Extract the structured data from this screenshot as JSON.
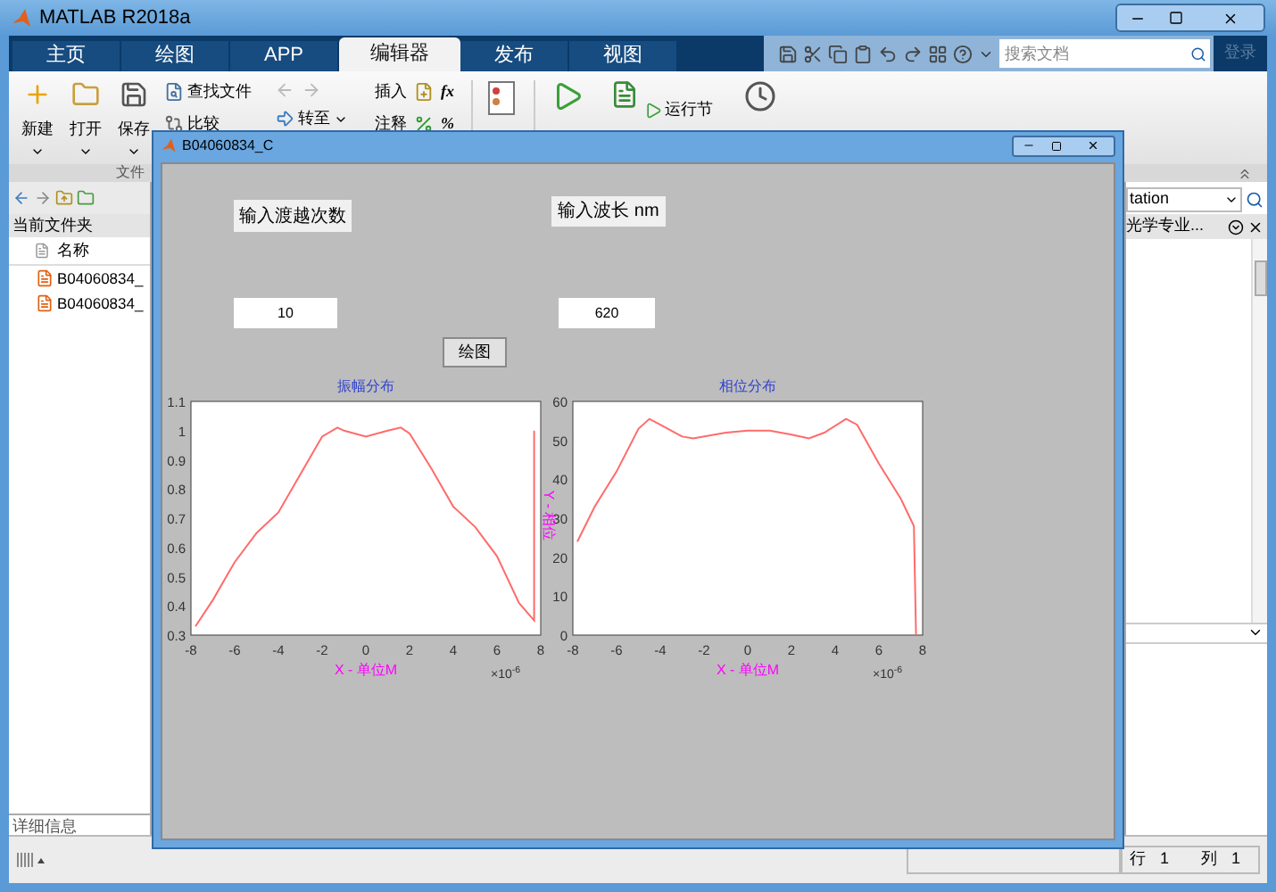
{
  "window": {
    "title": "MATLAB R2018a"
  },
  "tabs": [
    {
      "label": "主页",
      "selected": false
    },
    {
      "label": "绘图",
      "selected": false
    },
    {
      "label": "APP",
      "selected": false
    },
    {
      "label": "编辑器",
      "selected": true
    },
    {
      "label": "发布",
      "selected": false
    },
    {
      "label": "视图",
      "selected": false
    }
  ],
  "search": {
    "placeholder": "搜索文档"
  },
  "sign_in": "登录",
  "toolstrip": {
    "large_buttons": [
      {
        "label": "新建"
      },
      {
        "label": "打开"
      },
      {
        "label": "保存"
      }
    ],
    "file_buttons": [
      "查找文件",
      "比较"
    ],
    "navigate_buttons": [
      "转至"
    ],
    "edit_buttons": [
      "插入",
      "注释"
    ],
    "edit_symbols": [
      "fx",
      "%"
    ],
    "run_buttons": [
      "运行节"
    ],
    "section_label": "文件"
  },
  "left_panel": {
    "title": "当前文件夹",
    "column": "名称",
    "files": [
      "B04060834_",
      "B04060834_"
    ],
    "details": "详细信息"
  },
  "right_panel": {
    "field_value": "tation",
    "item": "光学专业..."
  },
  "status_bar": {
    "row_label": "行",
    "row": "1",
    "col_label": "列",
    "col": "1"
  },
  "figure": {
    "title": "B04060834_C",
    "controls": [
      {
        "kind": "label",
        "text": "输入渡越次数"
      },
      {
        "kind": "label",
        "text": "输入波长 nm"
      },
      {
        "kind": "field",
        "value": "10"
      },
      {
        "kind": "field",
        "value": "620"
      },
      {
        "kind": "button",
        "text": "绘图"
      }
    ],
    "charts": [
      {
        "chart_data": {
          "type": "line",
          "title": "振幅分布",
          "xlabel": "X - 单位M",
          "x": [
            -7.8,
            -7,
            -6,
            -5,
            -4,
            -3,
            -2,
            -1.3,
            -1,
            0,
            1,
            1.6,
            2,
            3,
            4,
            5,
            6,
            7,
            7.7,
            7.7
          ],
          "series": [
            {
              "color": "#ff6b6b",
              "values": [
                0.33,
                0.42,
                0.55,
                0.65,
                0.72,
                0.85,
                0.98,
                1.01,
                1.0,
                0.98,
                1.0,
                1.01,
                0.99,
                0.87,
                0.74,
                0.67,
                0.57,
                0.41,
                0.35,
                1.0
              ]
            }
          ],
          "xlim": [
            -8,
            8
          ],
          "ylim": [
            0.3,
            1.1
          ],
          "xticks": [
            -8,
            -6,
            -4,
            -2,
            0,
            2,
            4,
            6,
            8
          ],
          "yticks": [
            0.3,
            0.4,
            0.5,
            0.6,
            0.7,
            0.8,
            0.9,
            1,
            1.1
          ],
          "annotations": [
            "×10$^{-6}$"
          ]
        }
      },
      {
        "chart_data": {
          "type": "line",
          "title": "相位分布",
          "xlabel": "X - 单位M",
          "ylabel": "Y - 相位",
          "x": [
            -7.8,
            -7,
            -6,
            -5,
            -4.5,
            -4,
            -3,
            -2.5,
            -1,
            0,
            1,
            2,
            2.8,
            3.5,
            4.5,
            5,
            6,
            7,
            7.6,
            7.7
          ],
          "series": [
            {
              "color": "#ff6b6b",
              "values": [
                24,
                33,
                42,
                53,
                55.5,
                54,
                51,
                50.5,
                52,
                52.5,
                52.5,
                51.5,
                50.5,
                52,
                55.5,
                54,
                44,
                35,
                28,
                0
              ]
            }
          ],
          "xlim": [
            -8,
            8
          ],
          "ylim": [
            0,
            60
          ],
          "xticks": [
            -8,
            -6,
            -4,
            -2,
            0,
            2,
            4,
            6,
            8
          ],
          "yticks": [
            0,
            10,
            20,
            30,
            40,
            50,
            60
          ],
          "annotations": [
            "×10$^{-6}$"
          ]
        }
      }
    ]
  }
}
